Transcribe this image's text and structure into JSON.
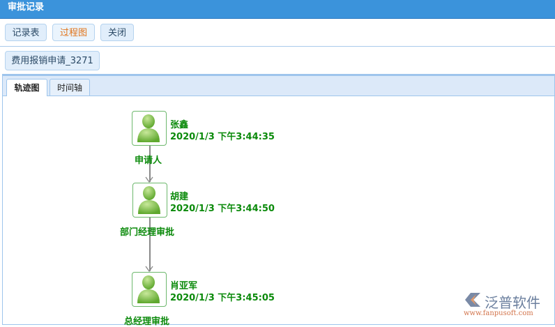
{
  "title": "审批记录",
  "toolbar": {
    "records": "记录表",
    "process": "过程图",
    "close": "关闭"
  },
  "document": {
    "label": "费用报销申请_3271"
  },
  "tabs": [
    "轨迹图",
    "时间轴"
  ],
  "nodes": [
    {
      "name": "张鑫",
      "time": "2020/1/3 下午3:44:35",
      "role": "申请人"
    },
    {
      "name": "胡建",
      "time": "2020/1/3 下午3:44:50",
      "role": "部门经理审批"
    },
    {
      "name": "肖亚军",
      "time": "2020/1/3 下午3:45:05",
      "role": "总经理审批"
    }
  ],
  "watermark": {
    "brand": "泛普软件",
    "url": "www.fanpusoft.com"
  }
}
